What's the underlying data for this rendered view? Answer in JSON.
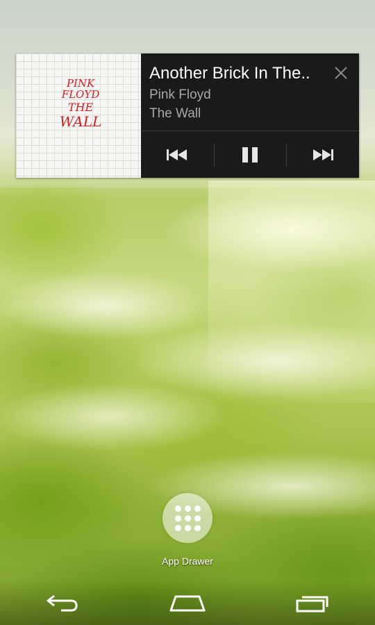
{
  "music_widget": {
    "album_art": {
      "line1": "PINK",
      "line2": "FLOYD",
      "line3": "THE",
      "line4": "WALL",
      "text_color": "#d21f1f"
    },
    "track_title": "Another Brick In The..",
    "artist": "Pink Floyd",
    "album": "The Wall",
    "close_icon": "close-icon",
    "controls": [
      {
        "name": "previous",
        "icon": "skip-previous-icon"
      },
      {
        "name": "pause",
        "icon": "pause-icon"
      },
      {
        "name": "next",
        "icon": "skip-next-icon"
      }
    ],
    "background_color": "#1a1a1a"
  },
  "app_drawer": {
    "label": "App Drawer",
    "icon": "app-grid-icon"
  },
  "nav_bar": {
    "buttons": [
      {
        "name": "back",
        "icon": "back-icon"
      },
      {
        "name": "home",
        "icon": "home-icon"
      },
      {
        "name": "recents",
        "icon": "recent-apps-icon"
      }
    ]
  }
}
